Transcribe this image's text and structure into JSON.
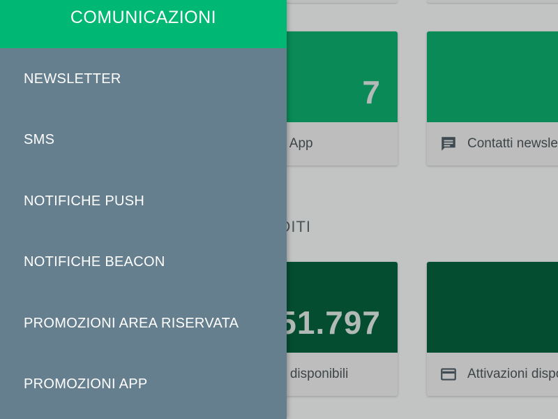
{
  "drawer": {
    "title": "COMUNICAZIONI",
    "items": [
      {
        "label": "NEWSLETTER"
      },
      {
        "label": "SMS"
      },
      {
        "label": "NOTIFICHE PUSH"
      },
      {
        "label": "NOTIFICHE BEACON"
      },
      {
        "label": "PROMOZIONI AREA RISERVATA"
      },
      {
        "label": "PROMOZIONI APP"
      }
    ],
    "colors": {
      "header": "#00b774",
      "background": "#667f8f"
    }
  },
  "dashboard": {
    "section_heading": "DITI",
    "cards": [
      {
        "value": "7",
        "label": "e App",
        "icon": "none",
        "color": "#0a8a57"
      },
      {
        "value": "",
        "label": "Contatti newslet",
        "icon": "chat-icon",
        "color": "#0a8a57"
      },
      {
        "value": "51.797",
        "label": "d disponibili",
        "icon": "none",
        "color": "#054d31"
      },
      {
        "value": "",
        "label": "Attivazioni dispo",
        "icon": "credit-card-icon",
        "color": "#054d31"
      }
    ]
  }
}
